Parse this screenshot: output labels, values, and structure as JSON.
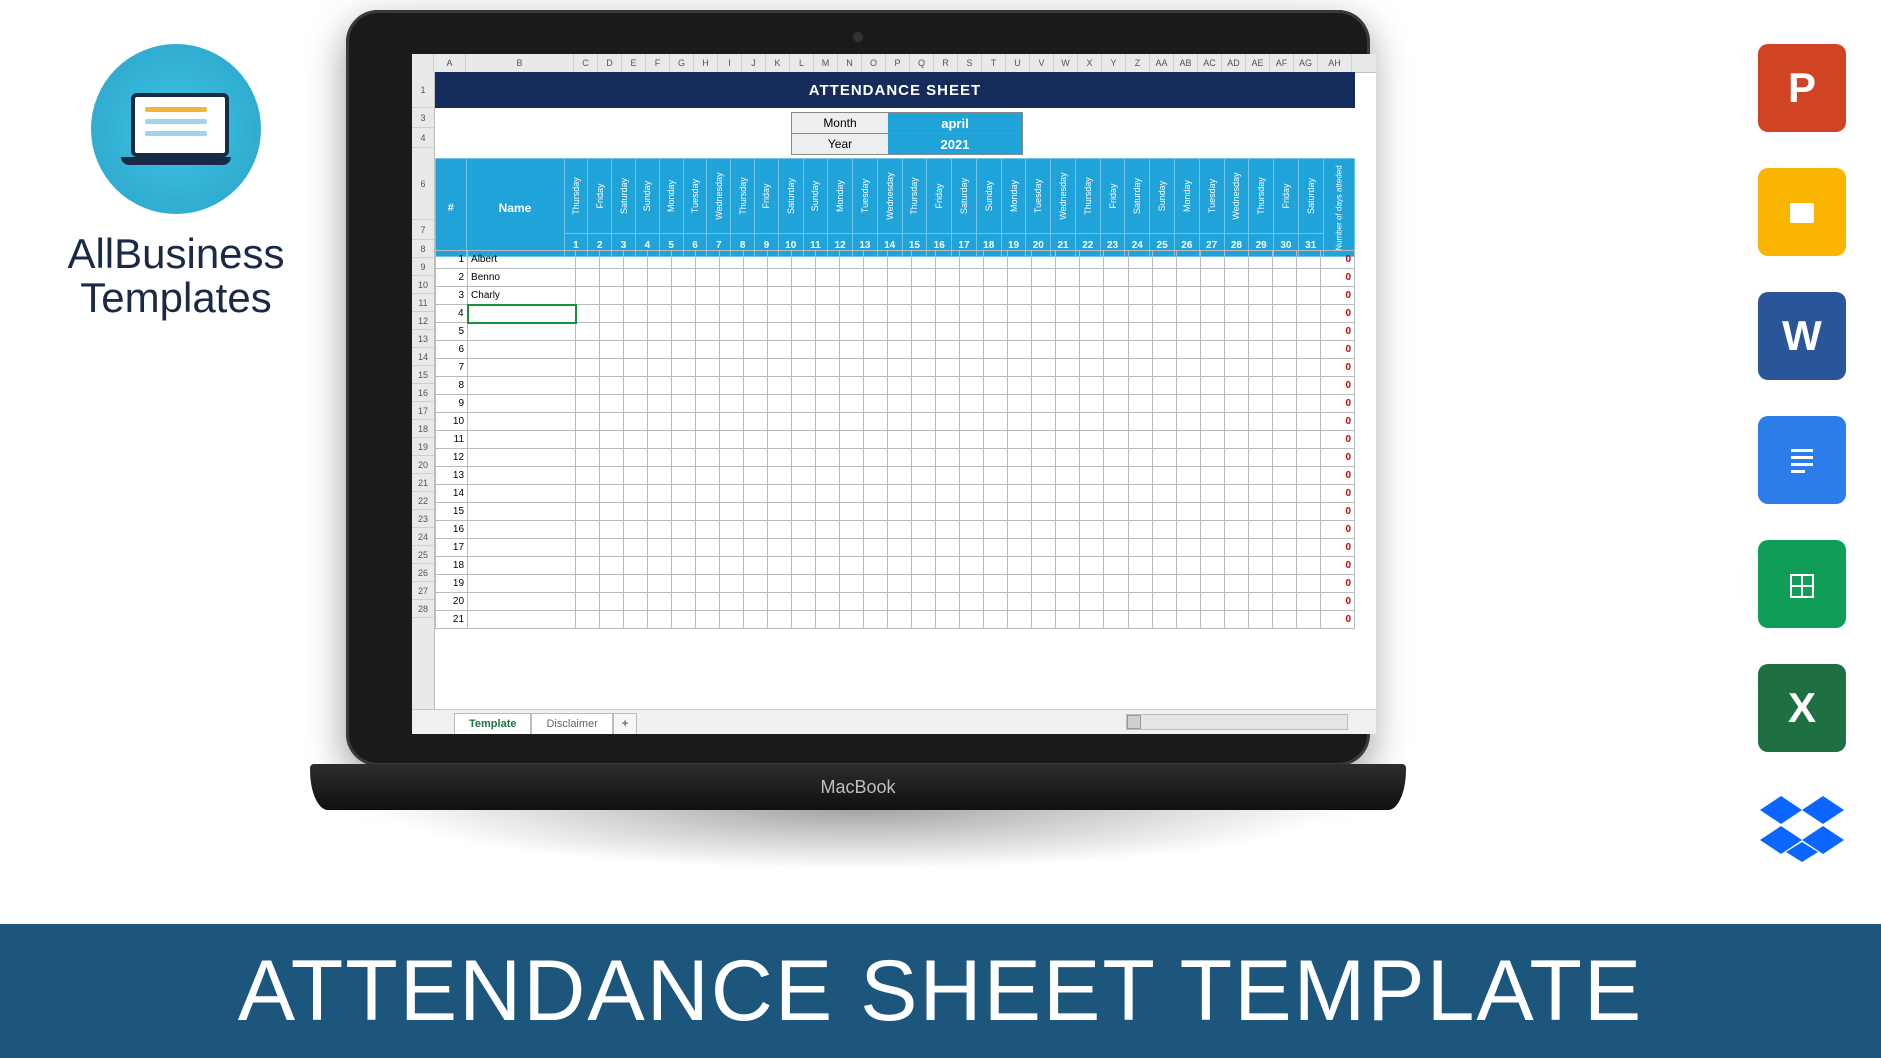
{
  "brand": {
    "line1": "AllBusiness",
    "line2": "Templates"
  },
  "apps": {
    "powerpoint": "P",
    "slides": "",
    "word": "W",
    "docs": "",
    "sheets": "",
    "excel": "X"
  },
  "banner": "ATTENDANCE SHEET TEMPLATE",
  "laptop_label": "MacBook",
  "columns": [
    "A",
    "B",
    "C",
    "D",
    "E",
    "F",
    "G",
    "H",
    "I",
    "J",
    "K",
    "L",
    "M",
    "N",
    "O",
    "P",
    "Q",
    "R",
    "S",
    "T",
    "U",
    "V",
    "W",
    "X",
    "Y",
    "Z",
    "AA",
    "AB",
    "AC",
    "AD",
    "AE",
    "AF",
    "AG",
    "AH"
  ],
  "row_headers_top": [
    "1",
    "3",
    "4",
    "6",
    "7"
  ],
  "row_headers_data": [
    "8",
    "9",
    "10",
    "11",
    "12",
    "13",
    "14",
    "15",
    "16",
    "17",
    "18",
    "19",
    "20",
    "21",
    "22",
    "23",
    "24",
    "25",
    "26",
    "27",
    "28"
  ],
  "sheet": {
    "title": "ATTENDANCE SHEET",
    "month_label": "Month",
    "month_value": "april",
    "year_label": "Year",
    "year_value": "2021",
    "num_header": "#",
    "name_header": "Name",
    "total_header": "Number of days atteded",
    "days": [
      "Thursday",
      "Friday",
      "Saturday",
      "Sunday",
      "Monday",
      "Tuesday",
      "Wednesday",
      "Thursday",
      "Friday",
      "Saturday",
      "Sunday",
      "Monday",
      "Tuesday",
      "Wednesday",
      "Thursday",
      "Friday",
      "Saturday",
      "Sunday",
      "Monday",
      "Tuesday",
      "Wednesday",
      "Thursday",
      "Friday",
      "Saturday",
      "Sunday",
      "Monday",
      "Tuesday",
      "Wednesday",
      "Thursday",
      "Friday",
      "Saturday"
    ],
    "daynums": [
      "1",
      "2",
      "3",
      "4",
      "5",
      "6",
      "7",
      "8",
      "9",
      "10",
      "11",
      "12",
      "13",
      "14",
      "15",
      "16",
      "17",
      "18",
      "19",
      "20",
      "21",
      "22",
      "23",
      "24",
      "25",
      "26",
      "27",
      "28",
      "29",
      "30",
      "31"
    ],
    "rows": [
      {
        "n": "1",
        "name": "Albert",
        "total": "0"
      },
      {
        "n": "2",
        "name": "Benno",
        "total": "0"
      },
      {
        "n": "3",
        "name": "Charly",
        "total": "0"
      },
      {
        "n": "4",
        "name": "",
        "total": "0",
        "selected": true
      },
      {
        "n": "5",
        "name": "",
        "total": "0"
      },
      {
        "n": "6",
        "name": "",
        "total": "0"
      },
      {
        "n": "7",
        "name": "",
        "total": "0"
      },
      {
        "n": "8",
        "name": "",
        "total": "0"
      },
      {
        "n": "9",
        "name": "",
        "total": "0"
      },
      {
        "n": "10",
        "name": "",
        "total": "0"
      },
      {
        "n": "11",
        "name": "",
        "total": "0"
      },
      {
        "n": "12",
        "name": "",
        "total": "0"
      },
      {
        "n": "13",
        "name": "",
        "total": "0"
      },
      {
        "n": "14",
        "name": "",
        "total": "0"
      },
      {
        "n": "15",
        "name": "",
        "total": "0"
      },
      {
        "n": "16",
        "name": "",
        "total": "0"
      },
      {
        "n": "17",
        "name": "",
        "total": "0"
      },
      {
        "n": "18",
        "name": "",
        "total": "0"
      },
      {
        "n": "19",
        "name": "",
        "total": "0"
      },
      {
        "n": "20",
        "name": "",
        "total": "0"
      },
      {
        "n": "21",
        "name": "",
        "total": "0"
      }
    ],
    "tabs": {
      "active": "Template",
      "inactive": "Disclaimer",
      "add": "+"
    }
  }
}
